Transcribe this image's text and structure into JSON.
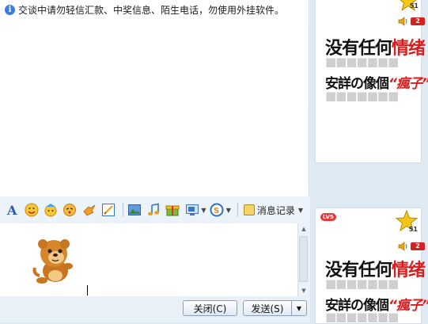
{
  "history": {
    "notice_icon": "info-icon",
    "notice_text": "交谈中请勿轻信汇款、中奖信息、陌生电话，勿使用外挂软件。"
  },
  "toolbar": {
    "icons": [
      "font-icon",
      "emoji-icon",
      "magic-emoji-icon",
      "shake-icon",
      "gift-icon",
      "scribble-icon",
      "image-icon",
      "music-icon",
      "send-gift-icon",
      "screenshot-icon",
      "q-search-icon"
    ],
    "history_label": "消息记录"
  },
  "buttons": {
    "close_label": "关闭(C)",
    "send_label": "发送(S)"
  },
  "right_panel": {
    "top_card": {
      "star_count": "51",
      "badge": "2",
      "line1_black": "没有任何",
      "line1_red": "情绪",
      "line2_black": "安詳の像個",
      "line2_red": "“瘋子”"
    },
    "bottom_card": {
      "level_badge": "LV5",
      "star_count": "51",
      "badge": "2",
      "line1_black": "没有任何",
      "line1_red": "情绪",
      "line2_black": "安詳の像個",
      "line2_red": "“瘋子”"
    }
  },
  "colors": {
    "accent_red": "#d91c1c",
    "panel_bg": "#dfeaf5",
    "button_border": "#8c9fb6"
  }
}
